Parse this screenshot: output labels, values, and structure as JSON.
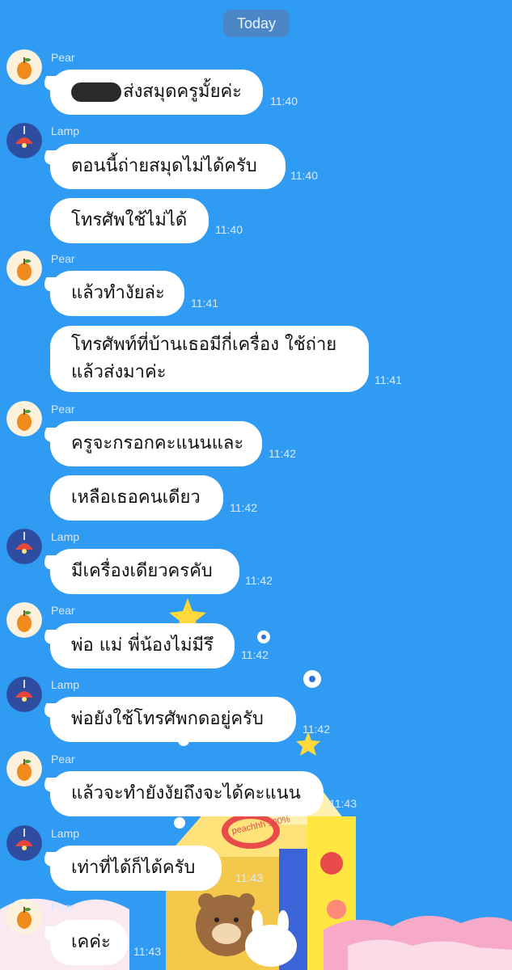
{
  "date_separator": "Today",
  "messages": [
    {
      "sender": "Pear",
      "text": "ส่งสมุดครูมั้ยค่ะ",
      "time": "11:40",
      "redacted_prefix": true
    },
    {
      "sender": "Lamp",
      "text": "ตอนนี้ถ่ายสมุดไม่ได้ครับ",
      "time": "11:40"
    },
    {
      "sender": "",
      "text": "โทรศัพใช้ไม่ได้",
      "time": "11:40"
    },
    {
      "sender": "Pear",
      "text": "แล้วทำงัยล่ะ",
      "time": "11:41"
    },
    {
      "sender": "",
      "text": "โทรศัพท์ที่บ้านเธอมีกี่เครื่อง ใช้ถ่าย",
      "text2": "แล้วส่งมาค่ะ",
      "time": "11:41"
    },
    {
      "sender": "Pear",
      "text": "ครูจะกรอกคะแนนและ",
      "time": "11:42"
    },
    {
      "sender": "",
      "text": "เหลือเธอคนเดียว",
      "time": "11:42"
    },
    {
      "sender": "Lamp",
      "text": "มีเครื่องเดียวครคับ",
      "time": "11:42"
    },
    {
      "sender": "Pear",
      "text": "พ่อ แม่ พี่น้องไม่มีรึ",
      "time": "11:42"
    },
    {
      "sender": "Lamp",
      "text": "พ่อยังใช้โทรศัพกดอยู่ครับ",
      "time": "11:42"
    },
    {
      "sender": "Pear",
      "text": "แล้วจะทำยังงัยถึงจะได้คะแนน",
      "time": "11:43"
    },
    {
      "sender": "Lamp",
      "text": "เท่าที่ได้ก็ได้ครับ",
      "time": "11:43"
    },
    {
      "sender": "Pear",
      "text": "เคค่ะ",
      "time": "11:43"
    }
  ],
  "sticker_text": "peachhh 100%",
  "colors": {
    "background": "#2f9bf2",
    "bubble": "#ffffff",
    "pear_avatar": "#f08a1c",
    "lamp_avatar": "#2e4da1"
  }
}
